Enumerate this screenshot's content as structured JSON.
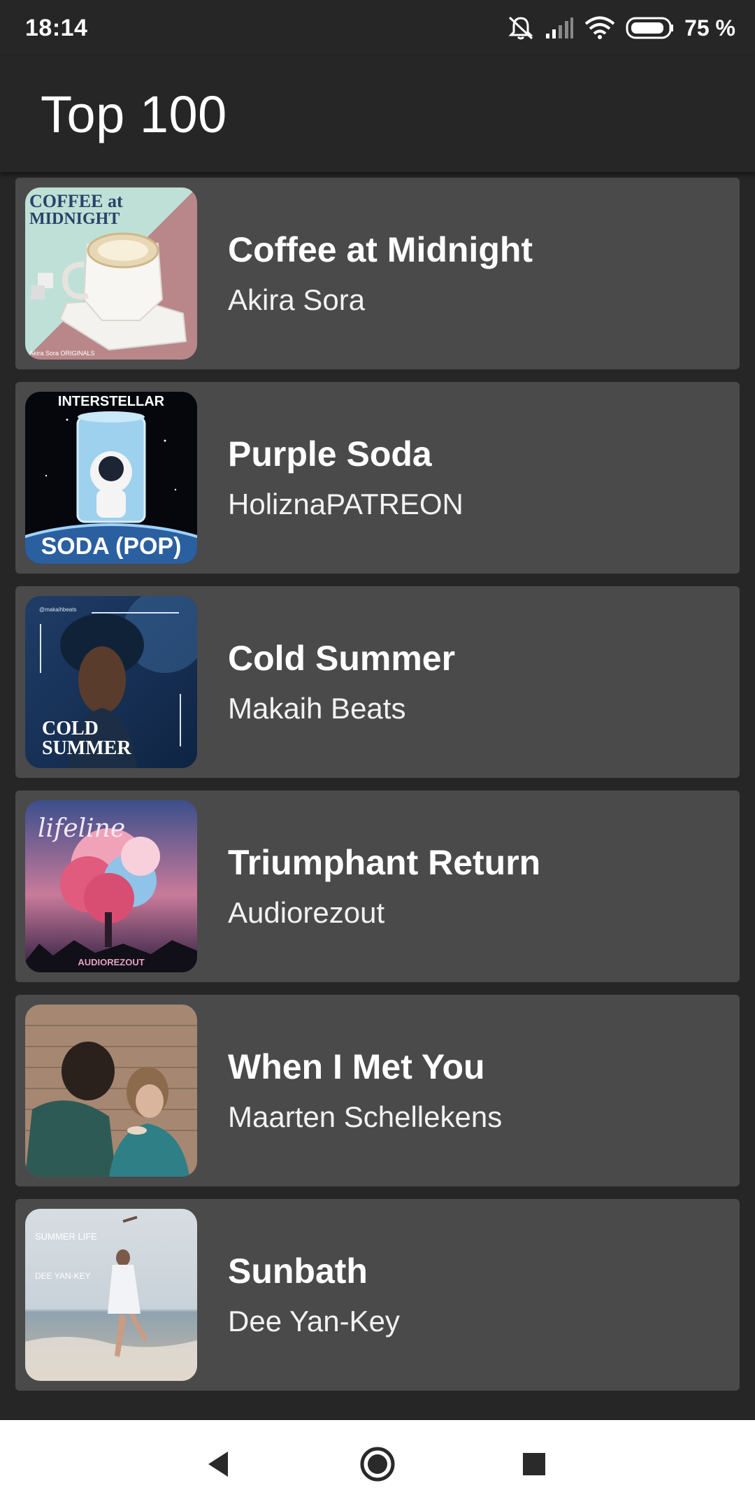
{
  "status_bar": {
    "time": "18:14",
    "battery_percent": "75 %",
    "icons": [
      "mute-icon",
      "signal-icon",
      "wifi-icon",
      "battery-icon"
    ]
  },
  "app_bar": {
    "title": "Top 100"
  },
  "tracks": [
    {
      "title": "Coffee at Midnight",
      "artist": "Akira Sora",
      "cover_text": [
        "COFFEE at",
        "MIDNIGHT"
      ],
      "cover_footer": "Akira Sora ORIGINALS"
    },
    {
      "title": "Purple Soda",
      "artist": "HoliznaPATREON",
      "cover_text": [
        "INTERSTELLAR",
        "SODA (POP)"
      ]
    },
    {
      "title": "Cold Summer",
      "artist": "Makaih Beats",
      "cover_text": [
        "@makaihbeats",
        "COLD",
        "SUMMER"
      ]
    },
    {
      "title": "Triumphant Return",
      "artist": "Audiorezout",
      "cover_text": [
        "lifeline",
        "AUDIOREZOUT"
      ]
    },
    {
      "title": "When I Met You",
      "artist": "Maarten Schellekens"
    },
    {
      "title": "Sunbath",
      "artist": "Dee Yan-Key",
      "cover_text": [
        "SUMMER LIFE",
        "DEE YAN-KEY"
      ]
    }
  ],
  "nav_bar": {
    "icons": [
      "back-icon",
      "home-icon",
      "recents-icon"
    ]
  }
}
